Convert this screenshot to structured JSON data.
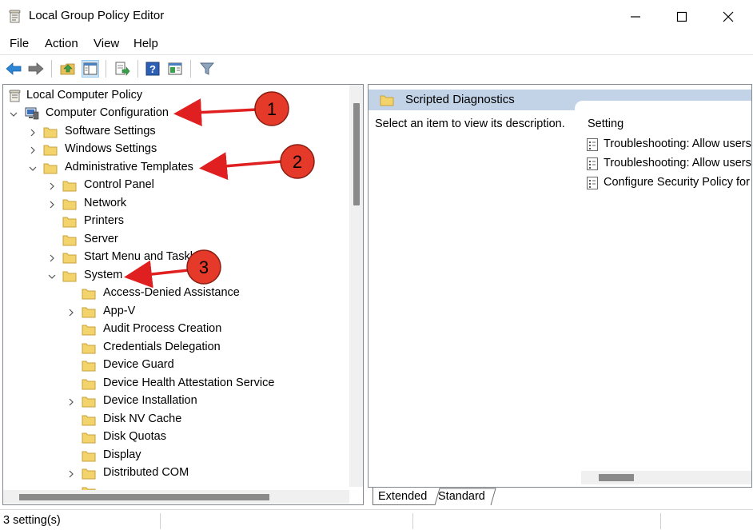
{
  "window": {
    "title": "Local Group Policy Editor",
    "app_icon": "policy-scroll-icon",
    "controls": [
      "minimize-icon",
      "maximize-icon",
      "close-icon"
    ]
  },
  "menu": [
    "File",
    "Action",
    "View",
    "Help"
  ],
  "toolbar": {
    "buttons": [
      "back-arrow-icon",
      "forward-arrow-icon",
      "up-folder-icon",
      "show-hide-tree-icon",
      "export-list-icon",
      "help-icon",
      "properties-view-icon",
      "filter-icon"
    ]
  },
  "tree": {
    "root": "Local Computer Policy",
    "computer_config": "Computer Configuration",
    "software_settings": "Software Settings",
    "windows_settings": "Windows Settings",
    "admin_templates": "Administrative Templates",
    "control_panel": "Control Panel",
    "network": "Network",
    "printers": "Printers",
    "server": "Server",
    "start_menu": "Start Menu and Taskb",
    "system": "System",
    "system_children": [
      "Access-Denied Assistance",
      "App-V",
      "Audit Process Creation",
      "Credentials Delegation",
      "Device Guard",
      "Device Health Attestation Service",
      "Device Installation",
      "Disk NV Cache",
      "Disk Quotas",
      "Display",
      "Distributed COM"
    ]
  },
  "details": {
    "header": "Scripted Diagnostics",
    "description": "Select an item to view its description.",
    "column_setting": "Setting",
    "settings": [
      "Troubleshooting: Allow users",
      "Troubleshooting: Allow users",
      "Configure Security Policy for"
    ]
  },
  "tabs": {
    "extended": "Extended",
    "standard": "Standard"
  },
  "status": {
    "text": "3 setting(s)"
  },
  "annotations": {
    "badge1": "1",
    "badge2": "2",
    "badge3": "3",
    "badge_color": "#e02020",
    "arrow_color": "#e02020"
  }
}
